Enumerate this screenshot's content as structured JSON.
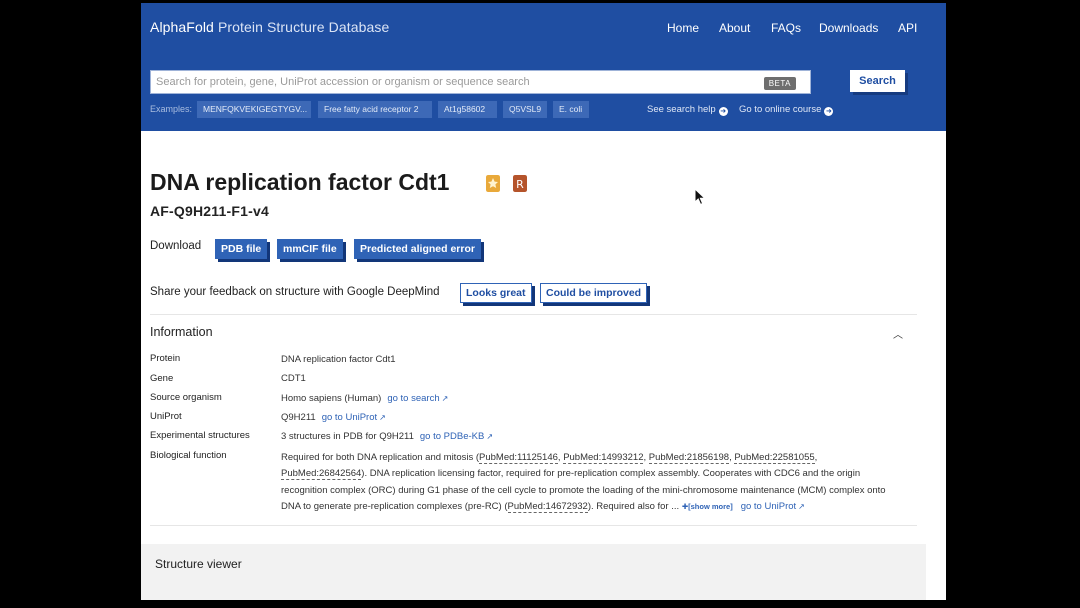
{
  "header": {
    "brand_bold": "AlphaFold",
    "brand_rest": " Protein Structure Database",
    "nav": [
      "Home",
      "About",
      "FAQs",
      "Downloads",
      "API"
    ]
  },
  "search": {
    "placeholder": "Search for protein, gene, UniProt accession or organism or sequence search",
    "beta": "BETA",
    "button": "Search",
    "examples_label": "Examples:",
    "examples": [
      "MENFQKVEKIGEGTYGV...",
      "Free fatty acid receptor 2",
      "At1g58602",
      "Q5VSL9",
      "E. coli"
    ],
    "help_link": "See search help",
    "course_link": "Go to online course"
  },
  "entry": {
    "title": "DNA replication factor Cdt1",
    "id": "AF-Q9H211-F1-v4"
  },
  "download": {
    "label": "Download",
    "buttons": [
      "PDB file",
      "mmCIF file",
      "Predicted aligned error"
    ]
  },
  "feedback": {
    "label": "Share your feedback on structure with Google DeepMind",
    "good": "Looks great",
    "improve": "Could be improved"
  },
  "information": {
    "heading": "Information",
    "protein_label": "Protein",
    "protein": "DNA replication factor Cdt1",
    "gene_label": "Gene",
    "gene": "CDT1",
    "organism_label": "Source organism",
    "organism": "Homo sapiens (Human)",
    "organism_link": "go to search",
    "uniprot_label": "UniProt",
    "uniprot": "Q9H211",
    "uniprot_link": "go to UniProt",
    "exp_label": "Experimental structures",
    "exp": "3 structures in PDB for Q9H211",
    "exp_link": "go to PDBe-KB",
    "bio_label": "Biological function",
    "bio_prefix": "Required for both DNA replication and mitosis (",
    "pubmed": [
      "PubMed:11125146",
      "PubMed:14993212",
      "PubMed:21856198",
      "PubMed:22581055",
      "PubMed:26842564",
      "PubMed:14672932"
    ],
    "bio_mid": "). DNA replication licensing factor, required for pre-replication complex assembly. Cooperates with CDC6 and the origin recognition complex (ORC) during G1 phase of the cell cycle to promote the loading of the mini-chromosome maintenance (MCM) complex onto DNA to generate pre-replication complexes (pre-RC) (",
    "bio_end": "). Required also for ...",
    "show_more": "[show more]",
    "bio_link": "go to UniProt"
  },
  "structure_viewer": {
    "heading": "Structure viewer"
  },
  "colors": {
    "header_bg": "#1f4ea2",
    "button_bg": "#2f63b6",
    "link": "#2f63b6"
  }
}
